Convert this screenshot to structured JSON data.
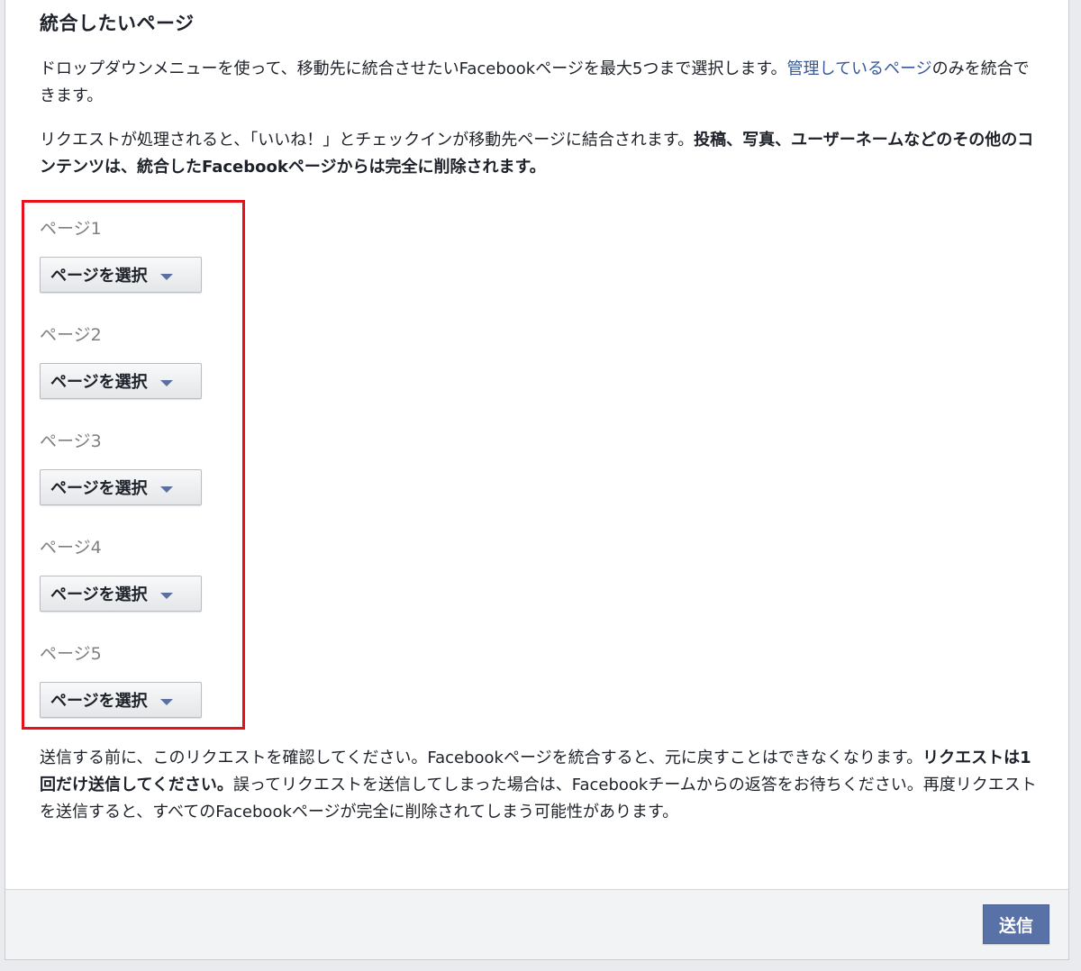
{
  "dialog": {
    "title": "統合したいページ",
    "intro": {
      "text": "ドロップダウンメニューを使って、移動先に統合させたいFacebookページを最大5つまで選択します。",
      "link": "管理しているページ",
      "text_after": "のみを統合できます。"
    },
    "notice": {
      "text": "リクエストが処理されると、「いいね！」とチェックインが移動先ページに結合されます。",
      "bold": "投稿、写真、ユーザーネームなどのその他のコンテンツは、統合したFacebookページからは完全に削除されます。"
    },
    "pages": [
      {
        "label": "ページ1",
        "select_label": "ページを選択"
      },
      {
        "label": "ページ2",
        "select_label": "ページを選択"
      },
      {
        "label": "ページ3",
        "select_label": "ページを選択"
      },
      {
        "label": "ページ4",
        "select_label": "ページを選択"
      },
      {
        "label": "ページ5",
        "select_label": "ページを選択"
      }
    ],
    "warning": {
      "text1": "送信する前に、このリクエストを確認してください。Facebookページを統合すると、元に戻すことはできなくなります。",
      "bold": "リクエストは1回だけ送信してください。",
      "text2": "誤ってリクエストを送信してしまった場合は、Facebookチームからの返答をお待ちください。再度リクエストを送信すると、すべてのFacebookページが完全に削除されてしまう可能性があります。"
    },
    "footer": {
      "submit_label": "送信"
    }
  },
  "colors": {
    "link": "#365899",
    "highlight_border": "#e8101d",
    "submit_bg": "#5871a6"
  }
}
